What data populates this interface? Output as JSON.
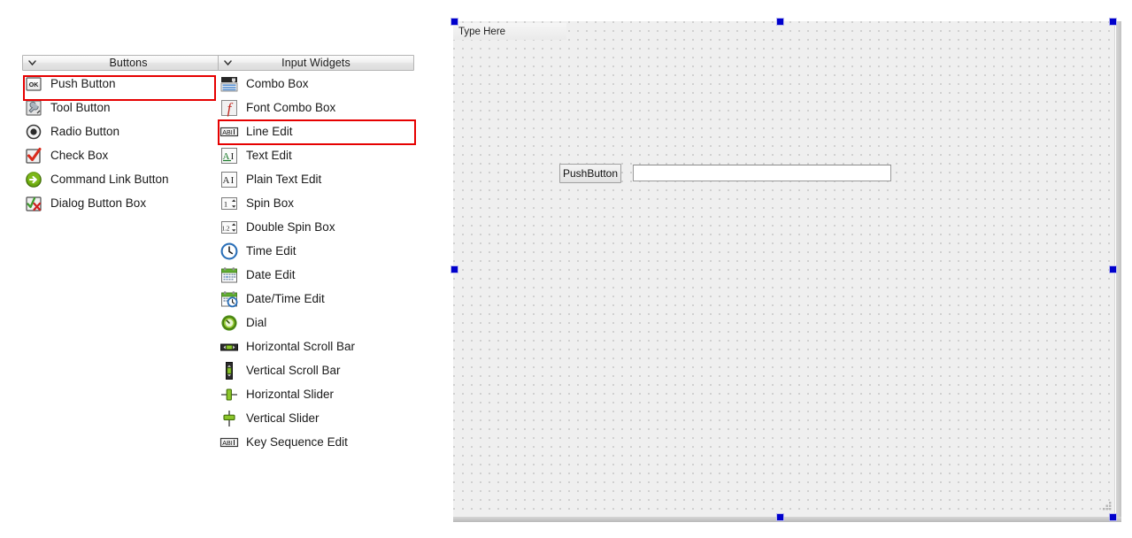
{
  "widget_box": {
    "buttons_section": {
      "title": "Buttons",
      "expand_icon": "chevron-down-icon",
      "items": [
        {
          "label": "Push Button",
          "icon": "push-button-icon"
        },
        {
          "label": "Tool Button",
          "icon": "tool-button-icon"
        },
        {
          "label": "Radio Button",
          "icon": "radio-button-icon"
        },
        {
          "label": "Check Box",
          "icon": "check-box-icon"
        },
        {
          "label": "Command Link Button",
          "icon": "command-link-button-icon"
        },
        {
          "label": "Dialog Button Box",
          "icon": "dialog-button-box-icon"
        }
      ]
    },
    "input_widgets_section": {
      "title": "Input Widgets",
      "expand_icon": "chevron-down-icon",
      "items": [
        {
          "label": "Combo Box",
          "icon": "combo-box-icon"
        },
        {
          "label": "Font Combo Box",
          "icon": "font-combo-box-icon"
        },
        {
          "label": "Line Edit",
          "icon": "line-edit-icon"
        },
        {
          "label": "Text Edit",
          "icon": "text-edit-icon"
        },
        {
          "label": "Plain Text Edit",
          "icon": "plain-text-edit-icon"
        },
        {
          "label": "Spin Box",
          "icon": "spin-box-icon"
        },
        {
          "label": "Double Spin Box",
          "icon": "double-spin-box-icon"
        },
        {
          "label": "Time Edit",
          "icon": "time-edit-icon"
        },
        {
          "label": "Date Edit",
          "icon": "date-edit-icon"
        },
        {
          "label": "Date/Time Edit",
          "icon": "date-time-edit-icon"
        },
        {
          "label": "Dial",
          "icon": "dial-icon"
        },
        {
          "label": "Horizontal Scroll Bar",
          "icon": "horizontal-scroll-bar-icon"
        },
        {
          "label": "Vertical Scroll Bar",
          "icon": "vertical-scroll-bar-icon"
        },
        {
          "label": "Horizontal Slider",
          "icon": "horizontal-slider-icon"
        },
        {
          "label": "Vertical Slider",
          "icon": "vertical-slider-icon"
        },
        {
          "label": "Key Sequence Edit",
          "icon": "key-sequence-edit-icon"
        }
      ]
    }
  },
  "form": {
    "menubar_placeholder": "Type Here",
    "widgets": {
      "push_button_label": "PushButton",
      "line_edit_value": "",
      "line_edit_placeholder": ""
    }
  },
  "annotations": {
    "highlight_color": "#e60000",
    "highlighted_items": [
      "Push Button",
      "Line Edit"
    ]
  },
  "selection": {
    "handle_color": "#0000cc"
  }
}
